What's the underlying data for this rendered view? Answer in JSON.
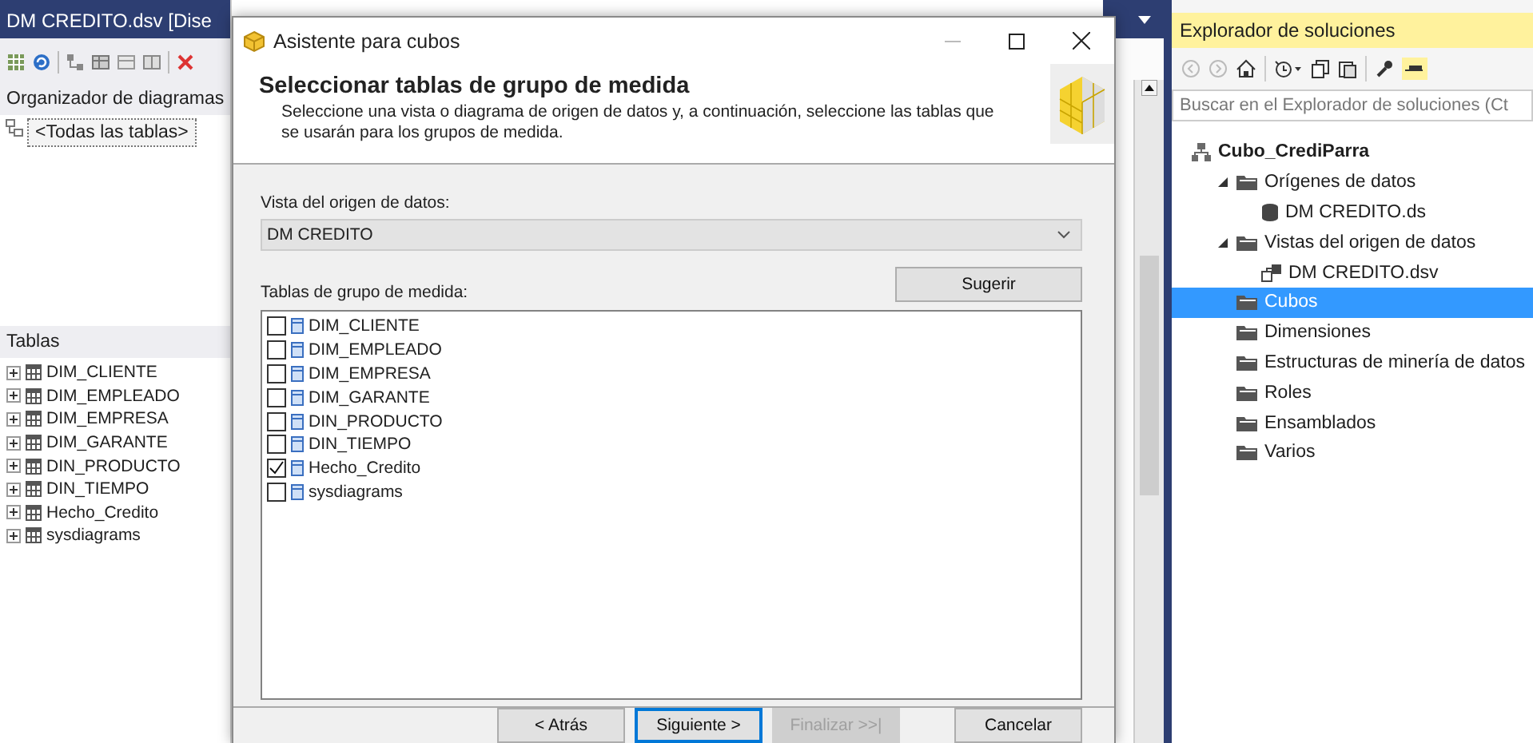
{
  "left_pane": {
    "title": "DM CREDITO.dsv [Dise",
    "organizer_label": "Organizador de diagramas",
    "diagram_item": "<Todas las tablas>",
    "tables_label": "Tablas",
    "tables": [
      "DIM_CLIENTE",
      "DIM_EMPLEADO",
      "DIM_EMPRESA",
      "DIM_GARANTE",
      "DIN_PRODUCTO",
      "DIN_TIEMPO",
      "Hecho_Credito",
      "sysdiagrams"
    ]
  },
  "dialog": {
    "title": "Asistente para cubos",
    "heading": "Seleccionar tablas de grupo de medida",
    "description": "Seleccione una vista o diagrama de origen de datos y, a continuación, seleccione las tablas que se usarán para los grupos de medida.",
    "view_label": "Vista del origen de datos:",
    "view_value": "DM CREDITO",
    "tables_label": "Tablas de grupo de medida:",
    "suggest_button": "Sugerir",
    "tables": [
      {
        "name": "DIM_CLIENTE",
        "checked": false
      },
      {
        "name": "DIM_EMPLEADO",
        "checked": false
      },
      {
        "name": "DIM_EMPRESA",
        "checked": false
      },
      {
        "name": "DIM_GARANTE",
        "checked": false
      },
      {
        "name": "DIN_PRODUCTO",
        "checked": false
      },
      {
        "name": "DIN_TIEMPO",
        "checked": false
      },
      {
        "name": "Hecho_Credito",
        "checked": true
      },
      {
        "name": "sysdiagrams",
        "checked": false
      }
    ],
    "buttons": [
      {
        "label": "< Atrás",
        "disabled": false,
        "focused": false
      },
      {
        "label": "Siguiente >",
        "disabled": false,
        "focused": true
      },
      {
        "label": "Finalizar >>|",
        "disabled": true,
        "focused": false
      },
      {
        "label": "Cancelar",
        "disabled": false,
        "focused": false
      }
    ]
  },
  "solution_explorer": {
    "title": "Explorador de soluciones",
    "search_placeholder": "Buscar en el Explorador de soluciones (Ct",
    "tree": [
      {
        "label": "Cubo_CrediParra",
        "kind": "project",
        "selected": false,
        "children": [
          {
            "label": "Orígenes de datos",
            "kind": "folder",
            "selected": false,
            "expanded": true,
            "children": [
              {
                "label": "DM CREDITO.ds",
                "kind": "datasource",
                "selected": false
              }
            ]
          },
          {
            "label": "Vistas del origen de datos",
            "kind": "folder",
            "selected": false,
            "expanded": true,
            "children": [
              {
                "label": "DM CREDITO.dsv",
                "kind": "dsv",
                "selected": false
              }
            ]
          },
          {
            "label": "Cubos",
            "kind": "folder",
            "selected": true
          },
          {
            "label": "Dimensiones",
            "kind": "folder",
            "selected": false
          },
          {
            "label": "Estructuras de minería de datos",
            "kind": "folder",
            "selected": false
          },
          {
            "label": "Roles",
            "kind": "folder",
            "selected": false
          },
          {
            "label": "Ensamblados",
            "kind": "folder",
            "selected": false
          },
          {
            "label": "Varios",
            "kind": "folder",
            "selected": false
          }
        ]
      }
    ]
  }
}
